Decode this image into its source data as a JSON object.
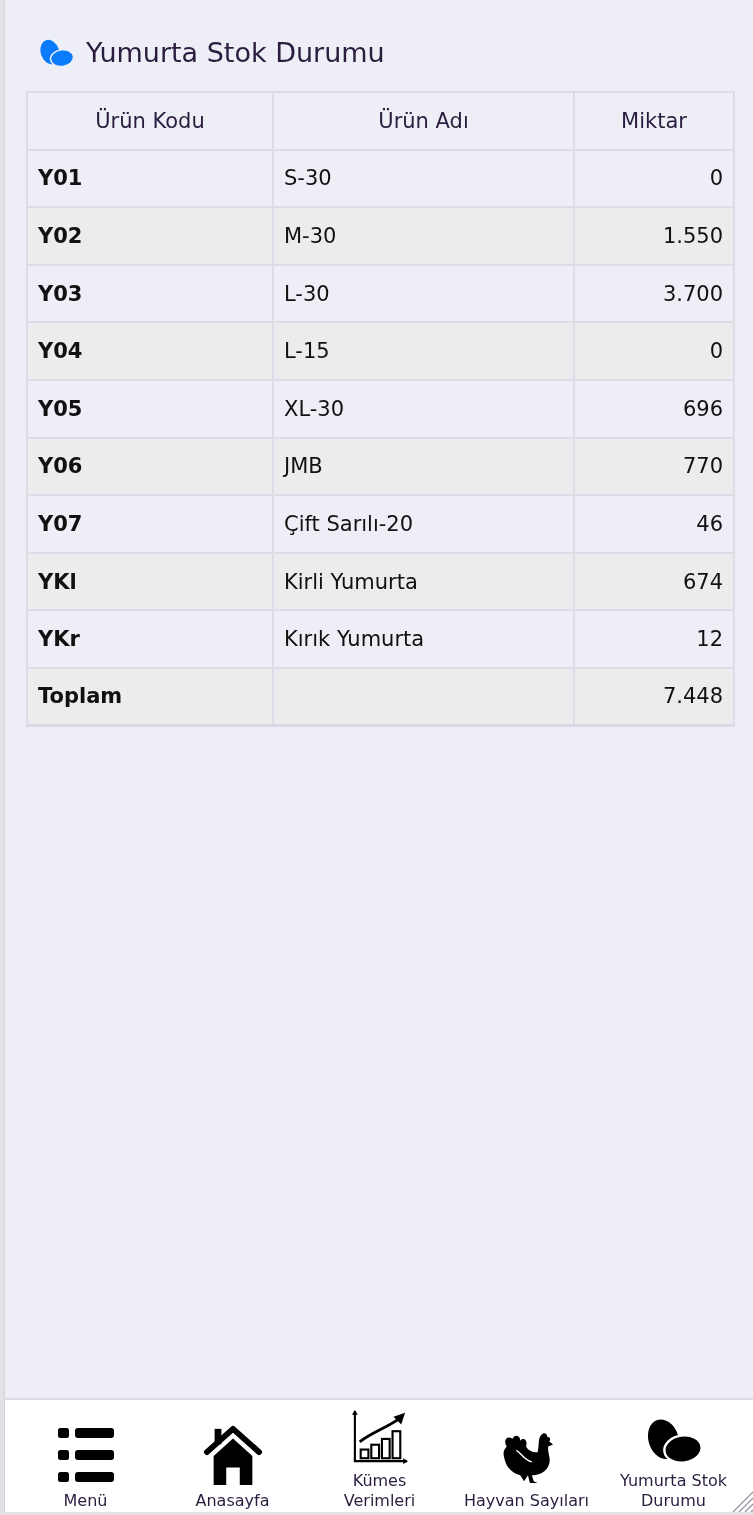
{
  "header": {
    "title": "Yumurta Stok Durumu"
  },
  "table": {
    "columns": [
      "Ürün Kodu",
      "Ürün Adı",
      "Miktar"
    ],
    "rows": [
      {
        "code": "Y01",
        "name": "S-30",
        "quantity": "0"
      },
      {
        "code": "Y02",
        "name": "M-30",
        "quantity": "1.550"
      },
      {
        "code": "Y03",
        "name": "L-30",
        "quantity": "3.700"
      },
      {
        "code": "Y04",
        "name": "L-15",
        "quantity": "0"
      },
      {
        "code": "Y05",
        "name": "XL-30",
        "quantity": "696"
      },
      {
        "code": "Y06",
        "name": "JMB",
        "quantity": "770"
      },
      {
        "code": "Y07",
        "name": "Çift Sarılı-20",
        "quantity": "46"
      },
      {
        "code": "YKl",
        "name": "Kirli Yumurta",
        "quantity": "674"
      },
      {
        "code": "YKr",
        "name": "Kırık Yumurta",
        "quantity": "12"
      }
    ],
    "total": {
      "label": "Toplam",
      "quantity": "7.448"
    }
  },
  "bottom_nav": {
    "items": [
      {
        "kind": "menu",
        "label": "Menü"
      },
      {
        "kind": "home",
        "label": "Anasayfa"
      },
      {
        "kind": "chart",
        "label": "Kümes Verimleri"
      },
      {
        "kind": "animals",
        "label": "Hayvan Sayıları"
      },
      {
        "kind": "eggs",
        "label": "Yumurta Stok Durumu"
      }
    ]
  }
}
